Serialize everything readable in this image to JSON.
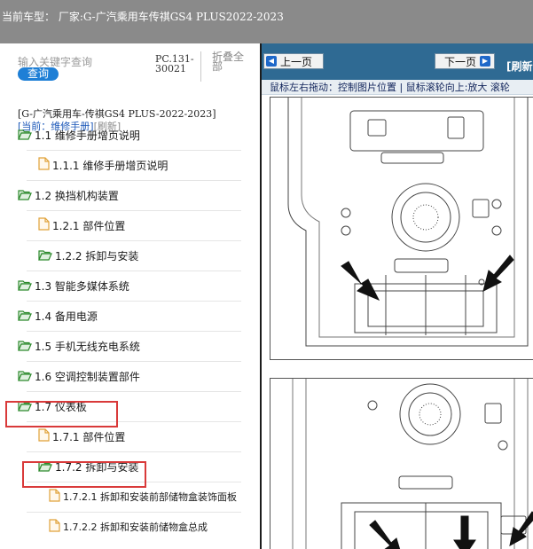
{
  "header": {
    "title": "当前车型： 厂家:G-广汽乘用车传祺GS4 PLUS2022-2023"
  },
  "left_panel": {
    "search": {
      "placeholder": "输入关键字查询",
      "button_label": "查询"
    },
    "pc_code": "PC.131-30021",
    "collapse_all_label": "折叠全部",
    "breadcrumb": "[G-广汽乘用车-传祺GS4 PLUS-2022-2023]",
    "current": {
      "label": "[当前：维修手册]",
      "refresh_label": "[刷新]"
    },
    "tree": [
      {
        "label": "1.1 维修手册增页说明",
        "icon": "folder-open-icon",
        "highlighted": false
      },
      {
        "label": "1.1.1 维修手册增页说明",
        "icon": "document-icon",
        "highlighted": false
      },
      {
        "label": "1.2 换挡机构装置",
        "icon": "folder-open-icon",
        "highlighted": false
      },
      {
        "label": "1.2.1 部件位置",
        "icon": "document-icon",
        "highlighted": false
      },
      {
        "label": "1.2.2 拆卸与安装",
        "icon": "folder-open-icon",
        "highlighted": false
      },
      {
        "label": "1.3 智能多媒体系统",
        "icon": "folder-open-icon",
        "highlighted": false
      },
      {
        "label": "1.4 备用电源",
        "icon": "folder-open-icon",
        "highlighted": false
      },
      {
        "label": "1.5 手机无线充电系统",
        "icon": "folder-open-icon",
        "highlighted": false
      },
      {
        "label": "1.6 空调控制装置部件",
        "icon": "folder-open-icon",
        "highlighted": false
      },
      {
        "label": "1.7 仪表板",
        "icon": "folder-open-icon",
        "highlighted": true
      },
      {
        "label": "1.7.1 部件位置",
        "icon": "document-icon",
        "highlighted": false
      },
      {
        "label": "1.7.2 拆卸与安装",
        "icon": "folder-open-icon",
        "highlighted": true
      },
      {
        "label": "1.7.2.1 拆卸和安装前部储物盒装饰面板",
        "icon": "document-icon",
        "highlighted": false
      },
      {
        "label": "1.7.2.2 拆卸和安装前储物盒总成",
        "icon": "document-icon",
        "highlighted": false
      }
    ]
  },
  "right_panel": {
    "prev_label": "上一页",
    "next_label": "下一页",
    "refresh_label": "[刷新",
    "hint": "鼠标左右拖动：控制图片位置 | 鼠标滚轮向上:放大  滚轮",
    "figures": [
      "front-storage-figure-1",
      "front-storage-figure-2"
    ]
  },
  "colors": {
    "topbar": "#8a8a8a",
    "nav": "#2f6a93",
    "button_blue": "#1e7fd6",
    "highlight": "#d93a3a",
    "folder_green": "#2d8a2d",
    "doc_orange": "#e0a23a"
  }
}
